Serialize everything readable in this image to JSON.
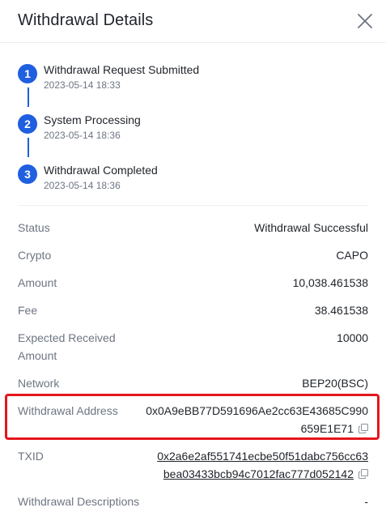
{
  "header": {
    "title": "Withdrawal Details"
  },
  "steps": [
    {
      "num": "1",
      "title": "Withdrawal Request Submitted",
      "time": "2023-05-14 18:33"
    },
    {
      "num": "2",
      "title": "System Processing",
      "time": "2023-05-14 18:36"
    },
    {
      "num": "3",
      "title": "Withdrawal Completed",
      "time": "2023-05-14 18:36"
    }
  ],
  "details": {
    "status": {
      "label": "Status",
      "value": "Withdrawal Successful"
    },
    "crypto": {
      "label": "Crypto",
      "value": "CAPO"
    },
    "amount": {
      "label": "Amount",
      "value": "10,038.461538"
    },
    "fee": {
      "label": "Fee",
      "value": "38.461538"
    },
    "expected": {
      "label_line1": "Expected Received",
      "label_line2": "Amount",
      "value": "10000"
    },
    "network": {
      "label": "Network",
      "value": "BEP20(BSC)"
    },
    "address": {
      "label": "Withdrawal Address",
      "line1": "0x0A9eBB77D591696Ae2cc63E43685C990",
      "line2": "659E1E71"
    },
    "txid": {
      "label": "TXID",
      "line1": "0x2a6e2af551741ecbe50f51dabc756cc63",
      "line2": "bea03433bcb94c7012fac777d052142"
    },
    "descriptions": {
      "label": "Withdrawal Descriptions",
      "value": "-"
    }
  },
  "colors": {
    "accent": "#1f5fe0",
    "highlight": "#e4161c"
  }
}
